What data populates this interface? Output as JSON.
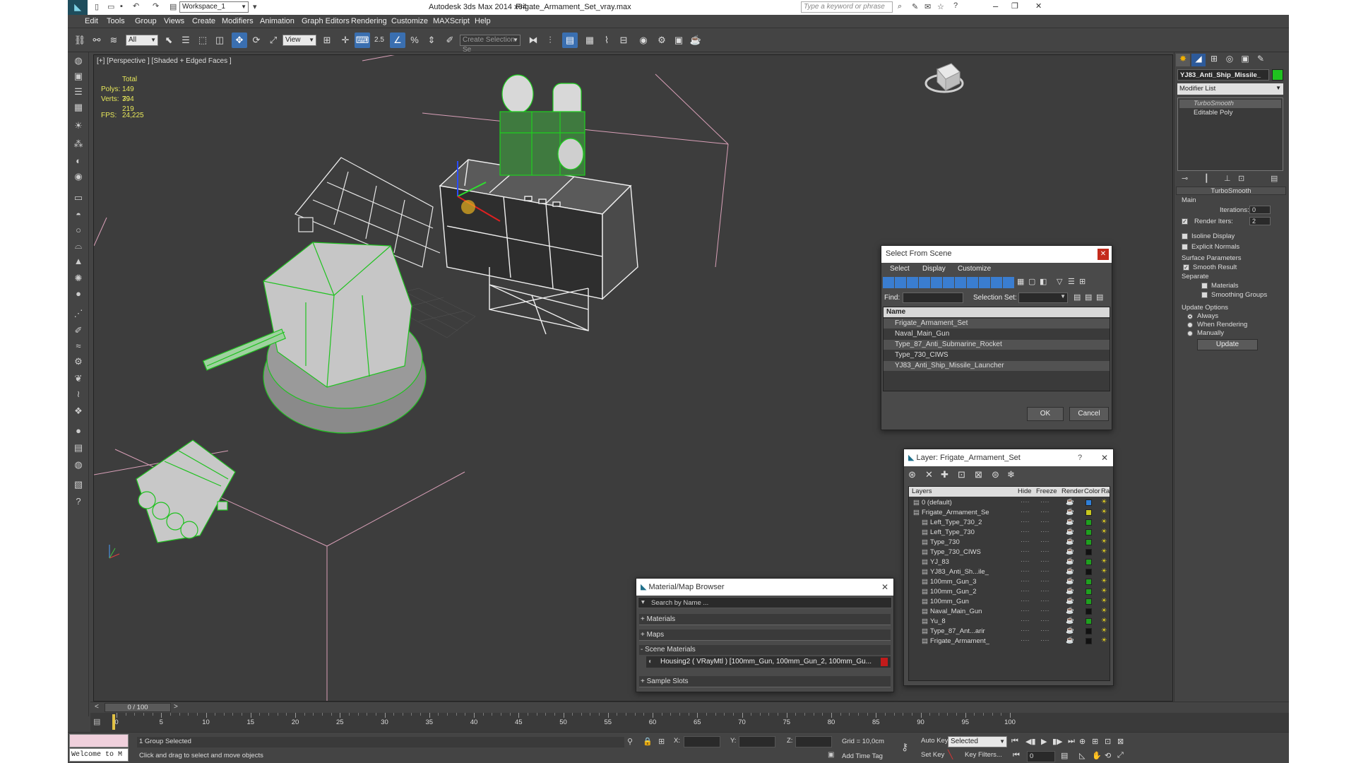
{
  "window": {
    "workspace": "Workspace_1",
    "app_title": "Autodesk 3ds Max  2014 x64",
    "file_title": "Frigate_Armament_Set_vray.max",
    "search_placeholder": "Type a keyword or phrase"
  },
  "menu": [
    "Edit",
    "Tools",
    "Group",
    "Views",
    "Create",
    "Modifiers",
    "Animation",
    "Graph Editors",
    "Rendering",
    "Customize",
    "MAXScript",
    "Help"
  ],
  "toolbar": {
    "selection_filter": "All",
    "ref_coord": "View",
    "snaps_label": "2.5",
    "selection_set_placeholder": "Create Selection Se"
  },
  "viewport": {
    "label": "[+] [Perspective ] [Shaded + Edged Faces ]",
    "stats_total": "Total",
    "polys_label": "Polys:",
    "polys_value": "149 394",
    "verts_label": "Verts:",
    "verts_value": "79 219",
    "fps_label": "FPS:",
    "fps_value": "24,225"
  },
  "command_panel": {
    "object_name": "YJ83_Anti_Ship_Missile_",
    "object_color": "#1fc21f",
    "modifier_list": "Modifier List",
    "stack": [
      "TurboSmooth",
      "Editable Poly"
    ],
    "rollout_title": "TurboSmooth",
    "main_label": "Main",
    "iterations_label": "Iterations:",
    "iterations_value": "0",
    "render_iters_label": "Render Iters:",
    "render_iters_value": "2",
    "isoline_label": "Isoline Display",
    "explicit_label": "Explicit Normals",
    "surface_params": "Surface Parameters",
    "smooth_result": "Smooth Result",
    "separate_label": "Separate",
    "materials_label": "Materials",
    "smoothing_groups_label": "Smoothing Groups",
    "update_options": "Update Options",
    "always": "Always",
    "when_rendering": "When Rendering",
    "manually": "Manually",
    "update_button": "Update"
  },
  "select_dialog": {
    "title": "Select From Scene",
    "tabs": [
      "Select",
      "Display",
      "Customize"
    ],
    "find_label": "Find:",
    "selection_set_label": "Selection Set:",
    "column_name": "Name",
    "items": [
      "Frigate_Armament_Set",
      "Naval_Main_Gun",
      "Type_87_Anti_Submarine_Rocket",
      "Type_730_CIWS",
      "YJ83_Anti_Ship_Missile_Launcher"
    ],
    "ok": "OK",
    "cancel": "Cancel"
  },
  "layer_dialog": {
    "title": "Layer: Frigate_Armament_Set",
    "help": "?",
    "columns": [
      "Layers",
      "Hide",
      "Freeze",
      "Render",
      "Color",
      "Radiosity"
    ],
    "rows": [
      {
        "name": "0 (default)",
        "color": "#2f7fd8"
      },
      {
        "name": "Frigate_Armament_Se",
        "color": "#c8c81e"
      },
      {
        "name": "Left_Type_730_2",
        "color": "#1fa01f"
      },
      {
        "name": "Left_Type_730",
        "color": "#1fa01f"
      },
      {
        "name": "Type_730",
        "color": "#1fa01f"
      },
      {
        "name": "Type_730_CIWS",
        "color": "#111111"
      },
      {
        "name": "YJ_83",
        "color": "#1fa01f"
      },
      {
        "name": "YJ83_Anti_Sh...ile_",
        "color": "#111111"
      },
      {
        "name": "100mm_Gun_3",
        "color": "#1fa01f"
      },
      {
        "name": "100mm_Gun_2",
        "color": "#1fa01f"
      },
      {
        "name": "100mm_Gun",
        "color": "#1fa01f"
      },
      {
        "name": "Naval_Main_Gun",
        "color": "#111111"
      },
      {
        "name": "Yu_8",
        "color": "#1fa01f"
      },
      {
        "name": "Type_87_Ant...arir",
        "color": "#111111"
      },
      {
        "name": "Frigate_Armament_",
        "color": "#111111"
      }
    ]
  },
  "material_browser": {
    "title": "Material/Map Browser",
    "search_placeholder": "Search by Name ...",
    "groups": [
      "+ Materials",
      "+ Maps",
      "- Scene Materials"
    ],
    "scene_material": "Housing2  ( VRayMtl )  [100mm_Gun, 100mm_Gun_2, 100mm_Gu...",
    "sample_slots": "+ Sample Slots"
  },
  "timeline": {
    "frame_display": "0 / 100",
    "ticks": [
      "0",
      "5",
      "10",
      "15",
      "20",
      "25",
      "30",
      "35",
      "40",
      "45",
      "50",
      "55",
      "60",
      "65",
      "70",
      "75",
      "80",
      "85",
      "90",
      "95",
      "100"
    ]
  },
  "status": {
    "listener": "Welcome to M",
    "selection": "1 Group Selected",
    "prompt": "Click and drag to select and move objects",
    "x_label": "X:",
    "y_label": "Y:",
    "z_label": "Z:",
    "grid": "Grid = 10,0cm",
    "add_time_tag": "Add Time Tag",
    "auto_key": "Auto Key",
    "set_key": "Set Key",
    "key_mode": "Selected",
    "key_filters": "Key Filters...",
    "frame": "0"
  }
}
